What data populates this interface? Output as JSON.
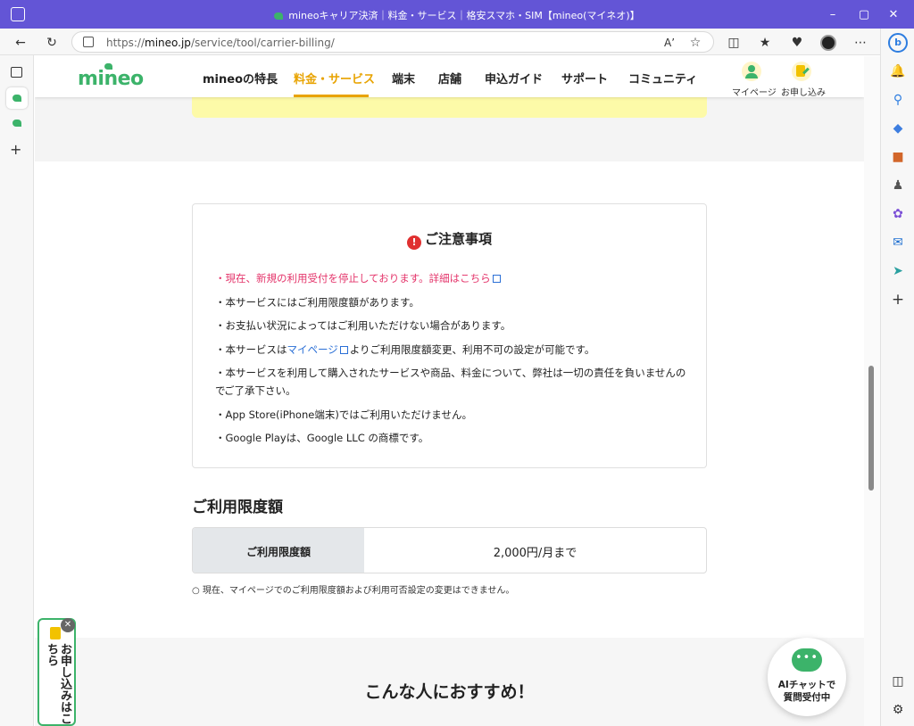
{
  "browser": {
    "title": "mineoキャリア決済｜料金・サービス｜格安スマホ・SIM【mineo(マイネオ)】",
    "url": "https://mineo.jp/service/tool/carrier-billing/",
    "url_domain": "mineo.jp",
    "url_path": "/service/tool/carrier-billing/",
    "read_aloud": "A’",
    "window_controls": {
      "minimize": "–",
      "maximize": "▢",
      "close": "✕"
    }
  },
  "site": {
    "logo": "mineo",
    "nav": [
      {
        "label": "mineoの特長",
        "active": false
      },
      {
        "label": "料金・サービス",
        "active": true
      },
      {
        "label": "端末",
        "active": false
      },
      {
        "label": "店舗",
        "active": false
      },
      {
        "label": "申込ガイド",
        "active": false
      },
      {
        "label": "サポート",
        "active": false
      },
      {
        "label": "コミュニティ",
        "active": false
      }
    ],
    "mypage_label": "マイページ",
    "apply_label": "お申し込み"
  },
  "notice": {
    "heading": "ご注意事項",
    "items": [
      {
        "pre": "・現在、新規の利用受付を停止しております。詳細は",
        "link": "こちら",
        "post": ""
      },
      {
        "pre": "・本サービスにはご利用限度額があります。",
        "link": "",
        "post": ""
      },
      {
        "pre": "・お支払い状況によってはご利用いただけない場合があります。",
        "link": "",
        "post": ""
      },
      {
        "pre": "・本サービスは",
        "link": "マイページ",
        "post": "よりご利用限度額変更、利用不可の設定が可能です。"
      },
      {
        "pre": "・本サービスを利用して購入されたサービスや商品、料金について、弊社は一切の責任を負いませんので",
        "link": "",
        "post": ""
      },
      {
        "pre": "ご了承下さい。",
        "link": "",
        "post": ""
      },
      {
        "pre": "・App Store(iPhone端末)ではご利用いただけません。",
        "link": "",
        "post": ""
      },
      {
        "pre": "・Google Playは、Google LLC の商標です。",
        "link": "",
        "post": ""
      }
    ]
  },
  "limit": {
    "heading": "ご利用限度額",
    "row_label": "ご利用限度額",
    "row_value": "2,000円/月まで",
    "note": "○ 現在、マイページでのご利用限度額および利用可否設定の変更はできません。"
  },
  "recommend": {
    "heading": "こんな人におすすめ！"
  },
  "float_apply": {
    "label": "お申し込みはこちら"
  },
  "ai_chat": {
    "line1": "AIチャットで",
    "line2": "質問受付中"
  },
  "colors": {
    "brand_green": "#3cb36a",
    "nav_active": "#e8a300",
    "titlebar": "#6355d6",
    "notice_red": "#e4356b",
    "link_blue": "#2a6fd6"
  }
}
